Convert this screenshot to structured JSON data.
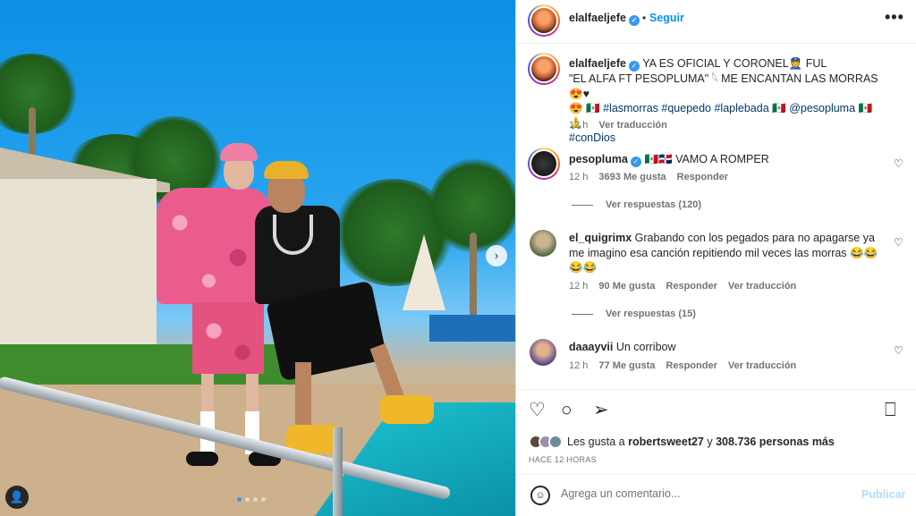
{
  "post": {
    "author": "elalfaeljefe",
    "follow_label": "Seguir",
    "more_label": "•••",
    "dot": "•",
    "caption_author": "elalfaeljefe",
    "caption_line1": "YA ES OFICIAL Y CORONEL👮 FUL",
    "caption_line2": "\"EL ALFA FT PESOPLUMA\" 𓆩 ME ENCANTAN LAS MORRAS 😍♥",
    "caption_line3_emoji": "😍 🇲🇽",
    "caption_tags": "#lasmorras #quepedo #laplebada",
    "caption_flag1": "🇲🇽",
    "caption_mention": "@pesopluma",
    "caption_flag2": "🇲🇽🙏",
    "caption_tag_last": "#conDios",
    "caption_time": "12 h",
    "caption_translate": "Ver traducción"
  },
  "comments": [
    {
      "user": "pesopluma",
      "text": "🇲🇽🇩🇴 VAMO A ROMPER",
      "time": "12 h",
      "likes": "3693 Me gusta",
      "reply": "Responder",
      "view_replies": "Ver respuestas (120)"
    },
    {
      "user": "el_quigrimx",
      "text_line1": "Grabando con los pegados para no apagarse ya",
      "text_line2": "me imagino esa canción repitiendo mil veces las morras 😂😂",
      "text_line3": "😂😂",
      "time": "12 h",
      "likes": "90 Me gusta",
      "reply": "Responder",
      "translate": "Ver traducción",
      "view_replies": "Ver respuestas (15)"
    },
    {
      "user": "daaayvii",
      "text": "Un corribow",
      "time": "12 h",
      "likes": "77 Me gusta",
      "reply": "Responder",
      "translate": "Ver traducción"
    }
  ],
  "actions": {
    "like_icon": "heart-icon",
    "comment_icon": "comment-icon",
    "share_icon": "send-icon",
    "save_icon": "bookmark-icon",
    "likes_prefix": "Les gusta a",
    "likes_user": "robertsweet27",
    "likes_mid": "y",
    "likes_count": "308.736 personas más",
    "ago": "HACE 12 HORAS"
  },
  "compose": {
    "placeholder": "Agrega un comentario...",
    "publish": "Publicar"
  },
  "colors": {
    "accent": "#0095f6",
    "text": "#262626",
    "muted": "#737373",
    "link": "#00376b"
  }
}
